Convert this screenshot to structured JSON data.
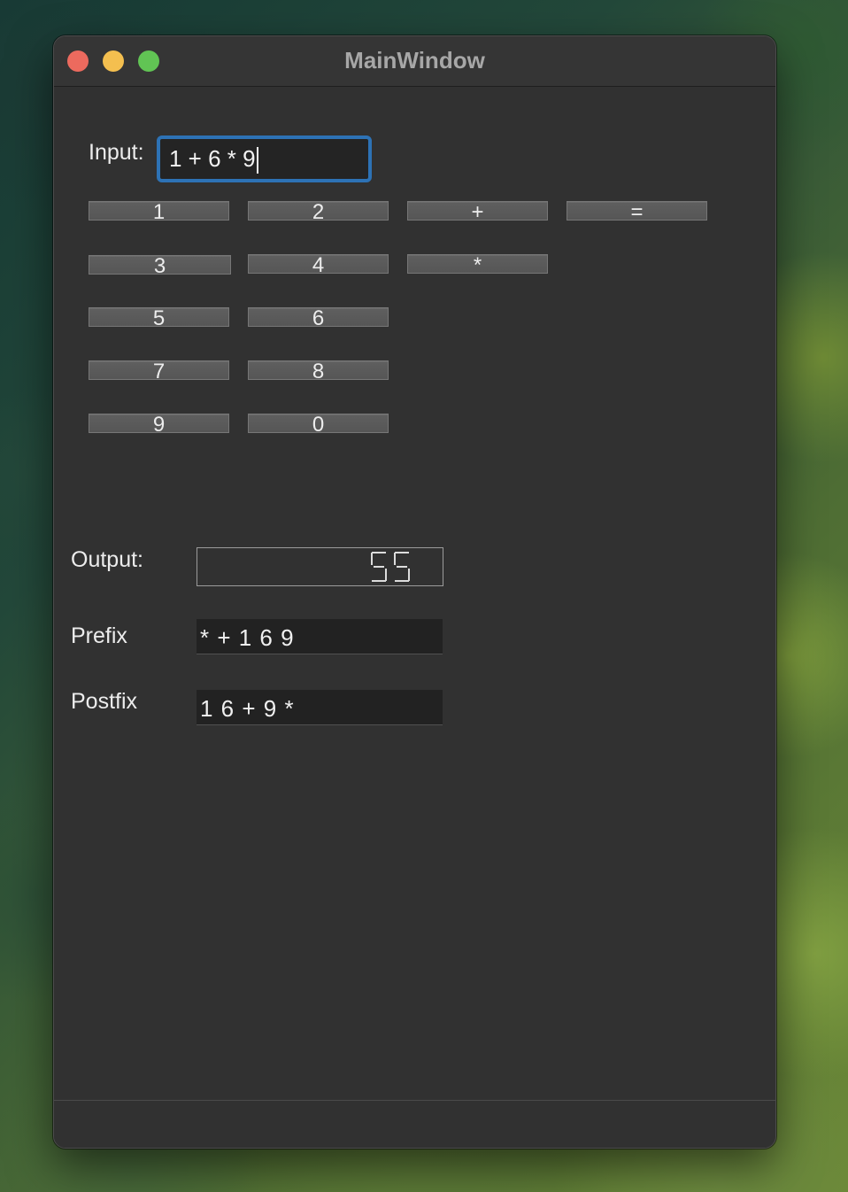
{
  "window": {
    "title": "MainWindow"
  },
  "input": {
    "label": "Input:",
    "value": "1 + 6 * 9"
  },
  "keypad": {
    "buttons": [
      "1",
      "2",
      "+",
      "=",
      "3",
      "4",
      "*",
      "5",
      "6",
      "7",
      "8",
      "9",
      "0"
    ]
  },
  "output": {
    "label": "Output:",
    "value": "55"
  },
  "prefix": {
    "label": "Prefix",
    "value": "* + 1 6 9"
  },
  "postfix": {
    "label": "Postfix",
    "value": "1 6 + 9 *"
  }
}
